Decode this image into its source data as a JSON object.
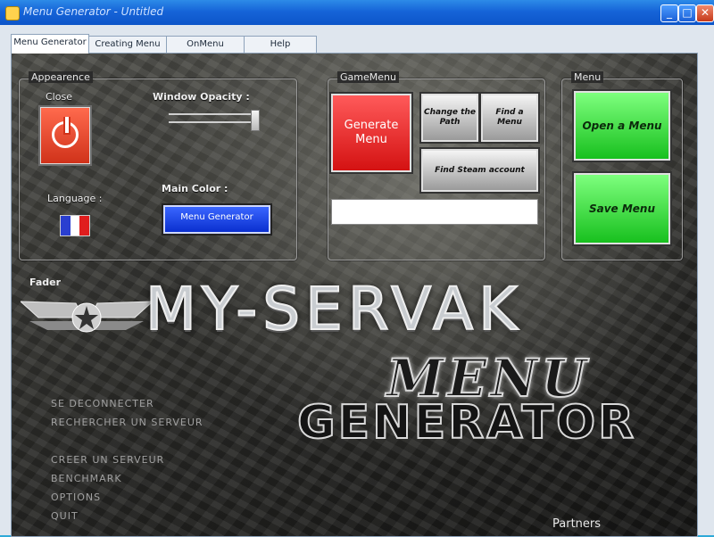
{
  "window": {
    "title": "Menu Generator - Untitled",
    "controls": {
      "minimize": "_",
      "maximize": "□",
      "close": "✕"
    }
  },
  "tabs": [
    "Menu Generator",
    "Creating Menu",
    "OnMenu",
    "Help"
  ],
  "appearance": {
    "title": "Appearence",
    "close_label": "Close",
    "opacity_label": "Window Opacity :",
    "opacity_value": 1.0,
    "language_label": "Language :",
    "language_flag": "france-flag",
    "main_color_label": "Main Color :",
    "main_color_button": "Menu Generator",
    "main_color": "#1e3fe6"
  },
  "game_menu": {
    "title": "GameMenu",
    "generate_button": "Generate Menu",
    "change_path_button": "Change the Path",
    "find_menu_button": "Find a Menu",
    "find_steam_button": "Find Steam account",
    "input_value": ""
  },
  "menu": {
    "title": "Menu",
    "open_button": "Open a Menu",
    "save_button": "Save Menu"
  },
  "branding": {
    "fader": "Fader",
    "logo": "MY-SERVAK",
    "title_line1": "MENU",
    "title_line2": "GENERATOR"
  },
  "side_menu": [
    "SE DECONNECTER",
    "RECHERCHER UN SERVEUR",
    "CREER UN SERVEUR",
    "BENCHMARK",
    "OPTIONS",
    "QUIT"
  ],
  "partners": "Partners",
  "colors": {
    "generate": "#e02020",
    "menu_buttons": "#2fd63a",
    "titlebar": "#1664d8"
  }
}
